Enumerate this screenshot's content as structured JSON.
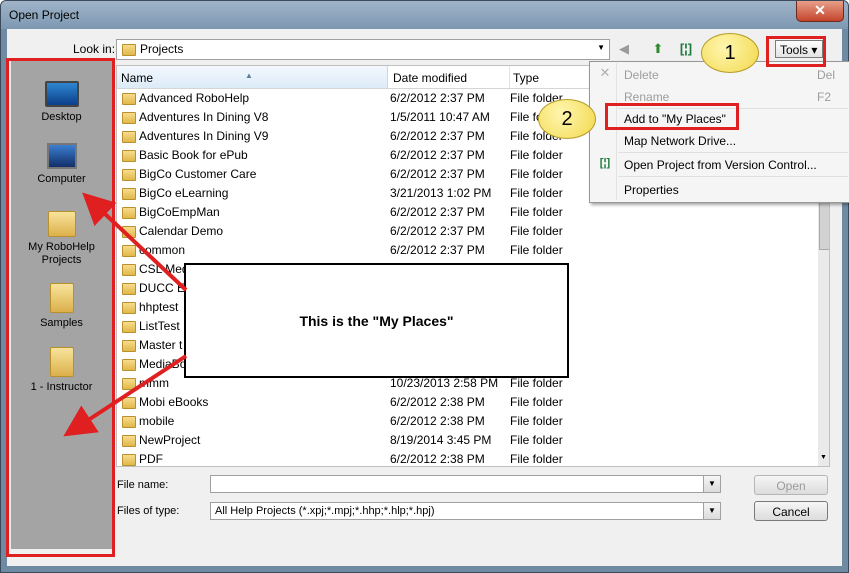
{
  "window": {
    "title": "Open Project",
    "close_icon": "✕"
  },
  "lookin": {
    "label": "Look in:",
    "value": "Projects"
  },
  "tools": {
    "label": "Tools ▾"
  },
  "places": [
    {
      "label": "Desktop",
      "icon": "desktop-icon"
    },
    {
      "label": "Computer",
      "icon": "computer-icon"
    },
    {
      "label": "My RoboHelp Projects",
      "icon": "robohelp-projects-icon"
    },
    {
      "label": "Samples",
      "icon": "folder-icon"
    },
    {
      "label": "1 - Instructor",
      "icon": "folder-icon"
    }
  ],
  "list": {
    "columns": [
      "Name",
      "Date modified",
      "Type"
    ],
    "rows": [
      {
        "name": "Advanced RoboHelp",
        "date": "6/2/2012 2:37 PM",
        "type": "File folder"
      },
      {
        "name": "Adventures In Dining V8",
        "date": "1/5/2011 10:47 AM",
        "type": "File folder"
      },
      {
        "name": "Adventures In Dining V9",
        "date": "6/2/2012 2:37 PM",
        "type": "File folder"
      },
      {
        "name": "Basic Book for ePub",
        "date": "6/2/2012 2:37 PM",
        "type": "File folder"
      },
      {
        "name": "BigCo Customer Care",
        "date": "6/2/2012 2:37 PM",
        "type": "File folder"
      },
      {
        "name": "BigCo eLearning",
        "date": "3/21/2013 1:02 PM",
        "type": "File folder"
      },
      {
        "name": "BigCoEmpMan",
        "date": "6/2/2012 2:37 PM",
        "type": "File folder"
      },
      {
        "name": "Calendar Demo",
        "date": "6/2/2012 2:37 PM",
        "type": "File folder"
      },
      {
        "name": "common",
        "date": "6/2/2012 2:37 PM",
        "type": "File folder"
      },
      {
        "name": "CSL Med",
        "date": "",
        "type": ""
      },
      {
        "name": "DUCC E",
        "date": "",
        "type": ""
      },
      {
        "name": "hhptest",
        "date": "",
        "type": ""
      },
      {
        "name": "ListTest",
        "date": "",
        "type": ""
      },
      {
        "name": "Master t",
        "date": "",
        "type": ""
      },
      {
        "name": "MediaBo",
        "date": "",
        "type": ""
      },
      {
        "name": "mmm",
        "date": "10/23/2013 2:58 PM",
        "type": "File folder"
      },
      {
        "name": "Mobi eBooks",
        "date": "6/2/2012 2:38 PM",
        "type": "File folder"
      },
      {
        "name": "mobile",
        "date": "6/2/2012 2:38 PM",
        "type": "File folder"
      },
      {
        "name": "NewProject",
        "date": "8/19/2014 3:45 PM",
        "type": "File folder"
      },
      {
        "name": "PDF",
        "date": "6/2/2012 2:38 PM",
        "type": "File folder"
      }
    ]
  },
  "filename": {
    "label": "File name:",
    "value": ""
  },
  "filetype": {
    "label": "Files of type:",
    "value": "All Help Projects (*.xpj;*.mpj;*.hhp;*.hlp;*.hpj)"
  },
  "buttons": {
    "open": "Open",
    "cancel": "Cancel"
  },
  "menu": {
    "items": [
      {
        "label": "Delete",
        "shortcut": "Del",
        "disabled": true,
        "icon": "delete-x-icon"
      },
      {
        "label": "Rename",
        "shortcut": "F2",
        "disabled": true,
        "icon": ""
      },
      {
        "label": "Add to \"My Places\"",
        "shortcut": "",
        "disabled": false,
        "icon": ""
      },
      {
        "label": "Map Network Drive...",
        "shortcut": "",
        "disabled": false,
        "icon": ""
      },
      {
        "label": "Open Project from Version Control...",
        "shortcut": "",
        "disabled": false,
        "icon": "version-control-icon"
      },
      {
        "label": "Properties",
        "shortcut": "",
        "disabled": false,
        "icon": ""
      }
    ]
  },
  "annotations": {
    "callout_text": "This is the \"My Places\"",
    "badge1": "1",
    "badge2": "2",
    "highlight_color": "#e02020",
    "badge_color": "#f2d84a"
  }
}
